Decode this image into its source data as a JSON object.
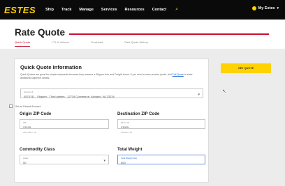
{
  "brand": {
    "logo": "ESTES",
    "accent": "#ffd200",
    "red": "#c8102e"
  },
  "nav": {
    "items": [
      "Ship",
      "Track",
      "Manage",
      "Services",
      "Resources",
      "Contact"
    ],
    "search_icon": "search-icon",
    "user_label": "My Estes"
  },
  "page": {
    "title": "Rate Quote",
    "tabs": [
      "Quick Quote",
      "LTL & Volume",
      "Truckload",
      "Past Quote History"
    ]
  },
  "card": {
    "title": "Quick Quote Information",
    "description": "Quick Quotes are great for simple shipments because they assume a Shipper-Into and Freight terms. If you need a more precise quote, visit",
    "description_link": "Full Quote",
    "description_tail": "to enter additional shipment details.",
    "account_field": {
      "label": "Account #",
      "value": "0574741 - Shipper - Third parties - 12734 Commerce, Ashland, VA 23234"
    },
    "default_checkbox": "Set as Default Account",
    "origin": {
      "heading": "Origin ZIP Code",
      "label": "ZIP",
      "value": "23105",
      "hint": "Glen Allen, VA"
    },
    "destination": {
      "heading": "Destination ZIP Code",
      "label": "Zip Code",
      "value": "23005",
      "hint": "Ashland, VA"
    },
    "commodity": {
      "heading": "Commodity Class",
      "label": "Class",
      "value": "50"
    },
    "weight": {
      "heading": "Total Weight",
      "label": "Total Weight (lbs)",
      "value": "500"
    }
  },
  "cta": {
    "label": "GET QUOTE"
  }
}
